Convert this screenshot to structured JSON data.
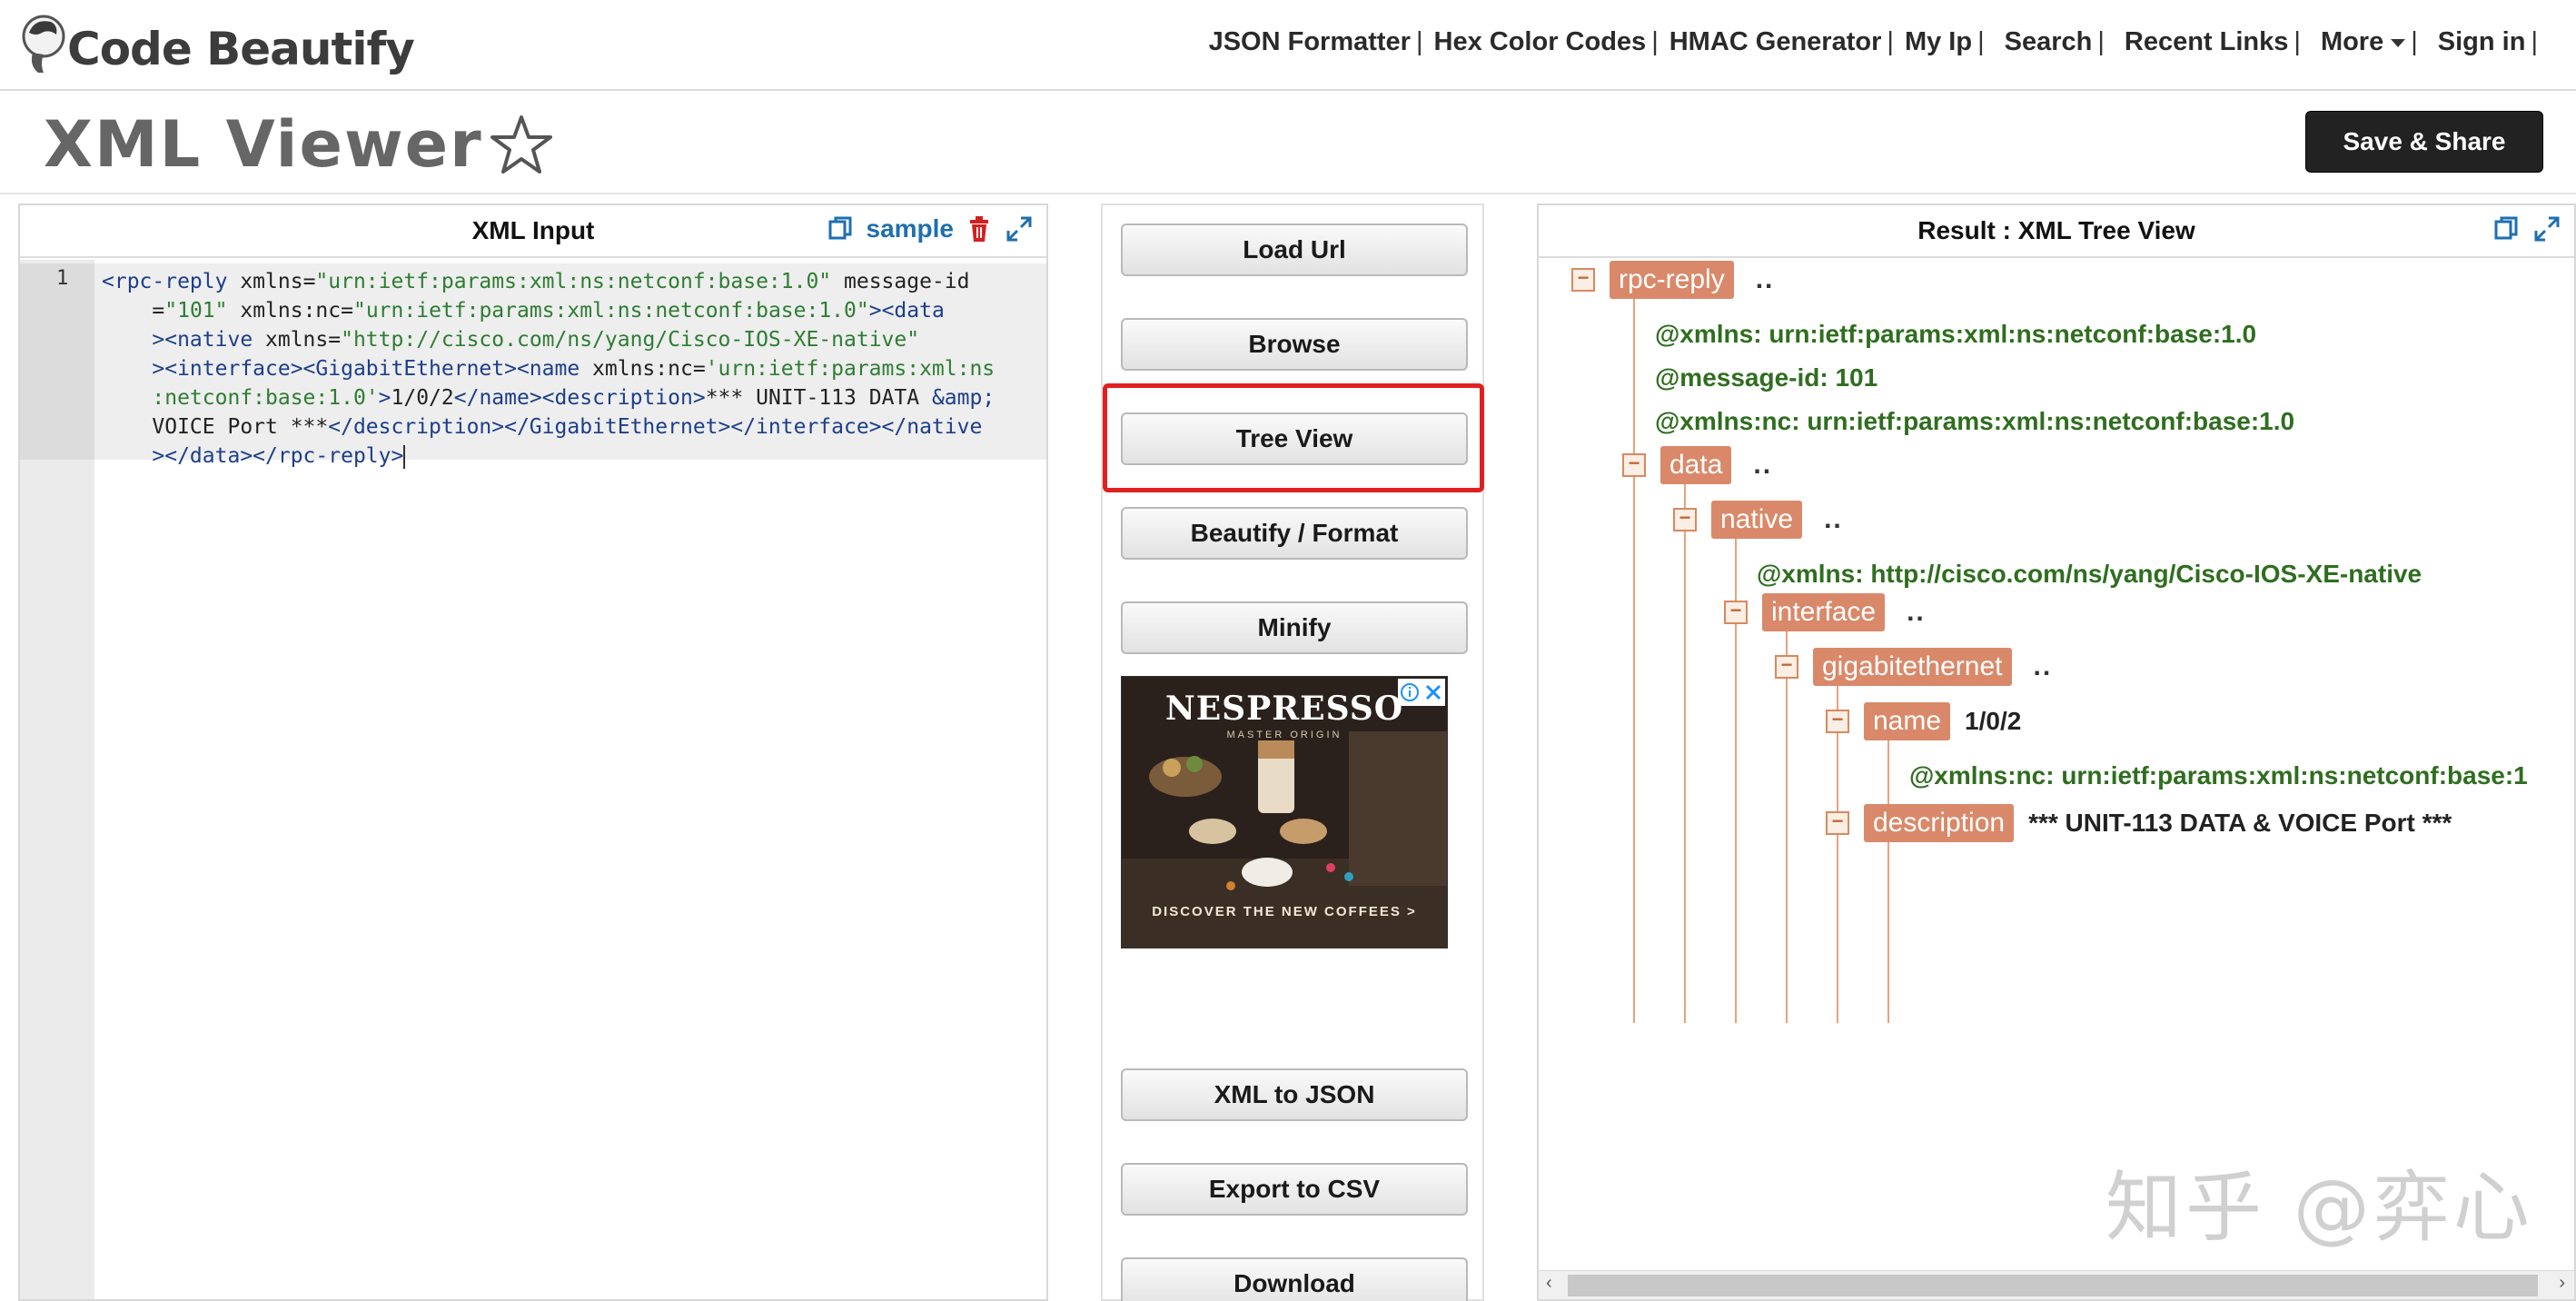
{
  "header": {
    "logo_text": "Code Beautify",
    "nav": [
      {
        "label": "JSON Formatter",
        "sep": "|"
      },
      {
        "label": "Hex Color Codes",
        "sep": "|"
      },
      {
        "label": "HMAC Generator",
        "sep": "|"
      },
      {
        "label": "My Ip",
        "sep": "|"
      },
      {
        "label": "Search",
        "sep": "|"
      },
      {
        "label": "Recent Links",
        "sep": "|"
      },
      {
        "label": "More",
        "sep": "|"
      },
      {
        "label": "Sign in",
        "sep": "|"
      }
    ]
  },
  "page": {
    "title": "XML Viewer",
    "star_icon": "star-outline-icon",
    "save_label": "Save & Share"
  },
  "input_panel": {
    "title": "XML Input",
    "sample_label": "sample",
    "line_number": "1",
    "code_lines": [
      [
        [
          "t",
          "<rpc-reply "
        ],
        [
          "a",
          "xmlns="
        ],
        [
          "v",
          "\"urn:ietf:params:xml:ns:netconf:base:1.0\""
        ],
        [
          "a",
          " message-id"
        ]
      ],
      [
        [
          "a",
          "    ="
        ],
        [
          "v",
          "\"101\""
        ],
        [
          "a",
          " xmlns:nc="
        ],
        [
          "v",
          "\"urn:ietf:params:xml:ns:netconf:base:1.0\""
        ],
        [
          "t",
          "><data"
        ]
      ],
      [
        [
          "t",
          "    ><native "
        ],
        [
          "a",
          "xmlns="
        ],
        [
          "v",
          "\"http://cisco.com/ns/yang/Cisco-IOS-XE-native\""
        ]
      ],
      [
        [
          "t",
          "    ><interface><GigabitEthernet><name "
        ],
        [
          "a",
          "xmlns:nc="
        ],
        [
          "v",
          "'urn:ietf:params:xml:ns"
        ]
      ],
      [
        [
          "v",
          "    :netconf:base:1.0'"
        ],
        [
          "t",
          ">"
        ],
        [
          "a",
          "1/0/2"
        ],
        [
          "t",
          "</name><description>"
        ],
        [
          "a",
          "*** UNIT-113 DATA "
        ],
        [
          "t",
          "&amp;"
        ]
      ],
      [
        [
          "a",
          "    VOICE Port ***"
        ],
        [
          "t",
          "</description></GigabitEthernet></interface></native"
        ]
      ],
      [
        [
          "t",
          "    ></data></rpc-reply>"
        ]
      ]
    ]
  },
  "actions": {
    "load_url": "Load Url",
    "browse": "Browse",
    "tree_view": "Tree View",
    "beautify": "Beautify / Format",
    "minify": "Minify",
    "xml_to_json": "XML to JSON",
    "export_csv": "Export to CSV",
    "download": "Download"
  },
  "ad": {
    "brand": "NESPRESSO",
    "sub": "MASTER ORIGIN",
    "cta": "DISCOVER THE NEW COFFEES >"
  },
  "result_panel": {
    "title": "Result : XML Tree View",
    "dots": "..",
    "nodes": {
      "rpc_reply": "rpc-reply",
      "data": "data",
      "native": "native",
      "interface": "interface",
      "gigabitethernet": "gigabitethernet",
      "name": "name",
      "name_value": "1/0/2",
      "description": "description",
      "description_value": "*** UNIT-113 DATA & VOICE Port ***"
    },
    "attrs": {
      "rpc_xmlns": "@xmlns:  urn:ietf:params:xml:ns:netconf:base:1.0",
      "rpc_message_id": "@message-id:  101",
      "rpc_xmlns_nc": "@xmlns:nc:  urn:ietf:params:xml:ns:netconf:base:1.0",
      "native_xmlns": "@xmlns:  http://cisco.com/ns/yang/Cisco-IOS-XE-native",
      "name_xmlns_nc": "@xmlns:nc:  urn:ietf:params:xml:ns:netconf:base:1"
    },
    "toggle_symbol": "−"
  },
  "watermark": "知乎 @弈心",
  "colors": {
    "tag_bg": "#d9896a",
    "attr_text": "#2f6e1f",
    "highlight": "#e02020",
    "save_bg": "#222222"
  }
}
